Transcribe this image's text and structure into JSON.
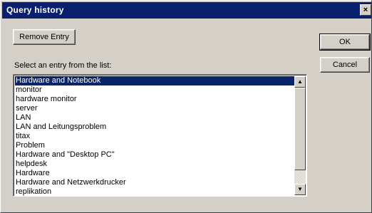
{
  "window": {
    "title": "Query history",
    "close_glyph": "×"
  },
  "buttons": {
    "remove_entry": "Remove Entry",
    "ok": "OK",
    "cancel": "Cancel"
  },
  "list": {
    "label": "Select an entry from the list:",
    "selected_index": 0,
    "items": [
      "Hardware and Notebook",
      "monitor",
      "hardware monitor",
      "server",
      "LAN",
      "LAN and Leitungsproblem",
      "titax",
      "Problem",
      "Hardware and \"Desktop PC\"",
      "helpdesk",
      "Hardware",
      "Hardware and Netzwerkdrucker",
      "replikation"
    ]
  },
  "scrollbar": {
    "up_glyph": "▲",
    "down_glyph": "▼"
  },
  "colors": {
    "titlebar": "#0a1f6e",
    "selection": "#0a246a",
    "dialog_face": "#d4d0c8"
  }
}
